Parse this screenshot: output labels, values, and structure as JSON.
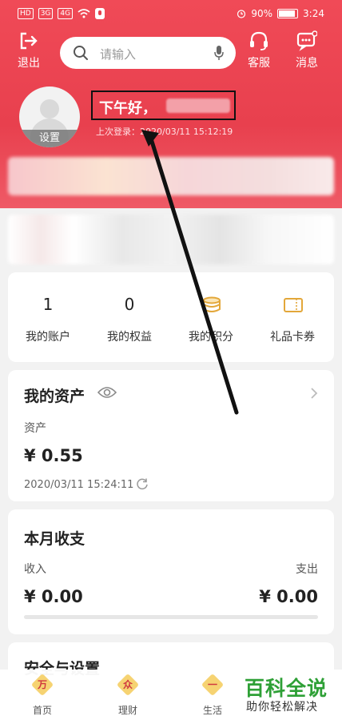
{
  "status_bar": {
    "left_chips": [
      "HD",
      "3G",
      "4G"
    ],
    "battery": "90%",
    "battery_level": 0.9,
    "time": "3:24"
  },
  "topbar": {
    "logout_label": "退出",
    "search_placeholder": "请输入",
    "service_label": "客服",
    "messages_label": "消息"
  },
  "profile": {
    "settings_label": "设置",
    "greeting": "下午好，",
    "last_login": "上次登录：2020/03/11 15:12:19"
  },
  "stats": [
    {
      "value": "1",
      "label": "我的账户"
    },
    {
      "value": "0",
      "label": "我的权益"
    },
    {
      "icon": "coins-icon",
      "label": "我的积分"
    },
    {
      "icon": "ticket-icon",
      "label": "礼品卡券"
    }
  ],
  "assets": {
    "title": "我的资产",
    "label": "资产",
    "amount": "¥ 0.55",
    "timestamp": "2020/03/11 15:24:11"
  },
  "month": {
    "title": "本月收支",
    "income_label": "收入",
    "expense_label": "支出",
    "income": "¥ 0.00",
    "expense": "¥ 0.00"
  },
  "security": {
    "title": "安全与设置"
  },
  "tabbar": [
    {
      "icon_char": "万",
      "label": "首页"
    },
    {
      "icon_char": "众",
      "label": "理财"
    },
    {
      "icon_char": "一",
      "label": "生活"
    }
  ],
  "watermark": {
    "title": "百科全说",
    "subtitle": "助你轻松解决"
  },
  "colors": {
    "brand_red": "#e8404e",
    "accent_gold": "#e3a73a",
    "watermark_green": "#2ea036"
  }
}
